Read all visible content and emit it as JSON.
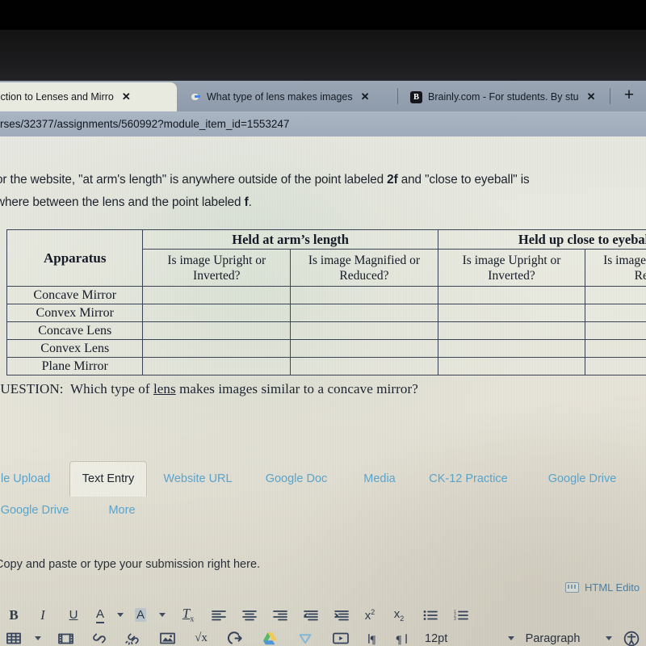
{
  "browser": {
    "tabs": [
      {
        "title": "troduction to Lenses and Mirro",
        "favicon": "none",
        "active": true,
        "close_label": "✕"
      },
      {
        "title": "What type of lens makes images",
        "favicon": "google-icon",
        "active": false,
        "close_label": "✕"
      },
      {
        "title": "Brainly.com - For students. By stu",
        "favicon": "brainly-icon",
        "active": false,
        "close_label": "✕"
      }
    ],
    "new_tab_label": "+",
    "url": "rses/32377/assignments/560992?module_item_id=1553247"
  },
  "assignment": {
    "intro_line1_a": "or the website, \"at arm's length\" is anywhere outside of the point labeled ",
    "intro_bold1": "2f",
    "intro_line1_b": " and \"close to eyeball\" is",
    "intro_line2_a": "where between the lens and the point labeled ",
    "intro_bold2": "f",
    "intro_line2_b": ".",
    "question_prefix": "QUESTION:",
    "question_a": "Which type of ",
    "question_underlined": "lens",
    "question_b": " makes images similar to a concave mirror?"
  },
  "worksheet": {
    "corner_header": "Apparatus",
    "group_headers": [
      "Held at arm’s length",
      "Held up close to eyeball"
    ],
    "sub_headers": [
      "Is image Upright or Inverted?",
      "Is image Magnified or Reduced?",
      "Is image Upright or Inverted?",
      "Is image Magnified or Reduced?"
    ],
    "rows": [
      {
        "label": "Concave Mirror",
        "cells": [
          "",
          "",
          "",
          ""
        ]
      },
      {
        "label": "Convex Mirror",
        "cells": [
          "",
          "",
          "",
          ""
        ]
      },
      {
        "label": "Concave Lens",
        "cells": [
          "",
          "",
          "",
          ""
        ]
      },
      {
        "label": "Convex Lens",
        "cells": [
          "",
          "",
          "",
          ""
        ]
      },
      {
        "label": "Plane Mirror",
        "cells": [
          "",
          "",
          "",
          ""
        ]
      }
    ]
  },
  "submission_tabs": {
    "row1": [
      {
        "label": "ile Upload",
        "selected": false
      },
      {
        "label": "Text Entry",
        "selected": true
      },
      {
        "label": "Website URL",
        "selected": false
      },
      {
        "label": "Google Doc",
        "selected": false
      },
      {
        "label": "Media",
        "selected": false
      },
      {
        "label": "CK-12 Practice",
        "selected": false
      },
      {
        "label": "Google Drive",
        "selected": false
      }
    ],
    "row2": [
      {
        "label": "Google Drive",
        "selected": false
      },
      {
        "label": "More",
        "selected": false
      }
    ]
  },
  "editor": {
    "body_text": "Copy and paste or type your submission right here.",
    "html_editor_label": "HTML Edito",
    "font_size_value": "12pt",
    "paragraph_style_value": "Paragraph",
    "toolbar_row1": [
      {
        "name": "bold-icon",
        "label": "B"
      },
      {
        "name": "italic-icon",
        "label": "I"
      },
      {
        "name": "underline-icon",
        "label": "U"
      },
      {
        "name": "text-color-icon",
        "label": "A"
      },
      {
        "name": "text-color-dropdown-icon",
        "label": ""
      },
      {
        "name": "highlight-color-icon",
        "label": "A"
      },
      {
        "name": "highlight-color-dropdown-icon",
        "label": ""
      },
      {
        "name": "clear-formatting-icon",
        "label": "Tx"
      },
      {
        "name": "align-left-icon",
        "label": ""
      },
      {
        "name": "align-center-icon",
        "label": ""
      },
      {
        "name": "align-right-icon",
        "label": ""
      },
      {
        "name": "outdent-icon",
        "label": ""
      },
      {
        "name": "indent-icon",
        "label": ""
      },
      {
        "name": "superscript-icon",
        "label": "x²"
      },
      {
        "name": "subscript-icon",
        "label": "x₂"
      },
      {
        "name": "bulleted-list-icon",
        "label": ""
      },
      {
        "name": "numbered-list-icon",
        "label": ""
      }
    ],
    "toolbar_row2": [
      {
        "name": "table-icon",
        "label": ""
      },
      {
        "name": "table-dropdown-icon",
        "label": ""
      },
      {
        "name": "media-icon",
        "label": ""
      },
      {
        "name": "link-icon",
        "label": ""
      },
      {
        "name": "unlink-icon",
        "label": ""
      },
      {
        "name": "image-icon",
        "label": ""
      },
      {
        "name": "math-equation-icon",
        "label": "√x"
      },
      {
        "name": "embed-icon",
        "label": ""
      },
      {
        "name": "google-drive-icon",
        "label": ""
      },
      {
        "name": "vimeo-icon",
        "label": "V"
      },
      {
        "name": "video-icon",
        "label": ""
      },
      {
        "name": "ltr-paragraph-icon",
        "label": "¶"
      },
      {
        "name": "rtl-paragraph-icon",
        "label": "¶"
      }
    ]
  },
  "colors": {
    "link_blue": "#5ba3c9",
    "paper": "#e7e9e2",
    "chrome_blue": "#9aa6b4",
    "table_border": "#3a4455",
    "ink": "#1c222c"
  }
}
